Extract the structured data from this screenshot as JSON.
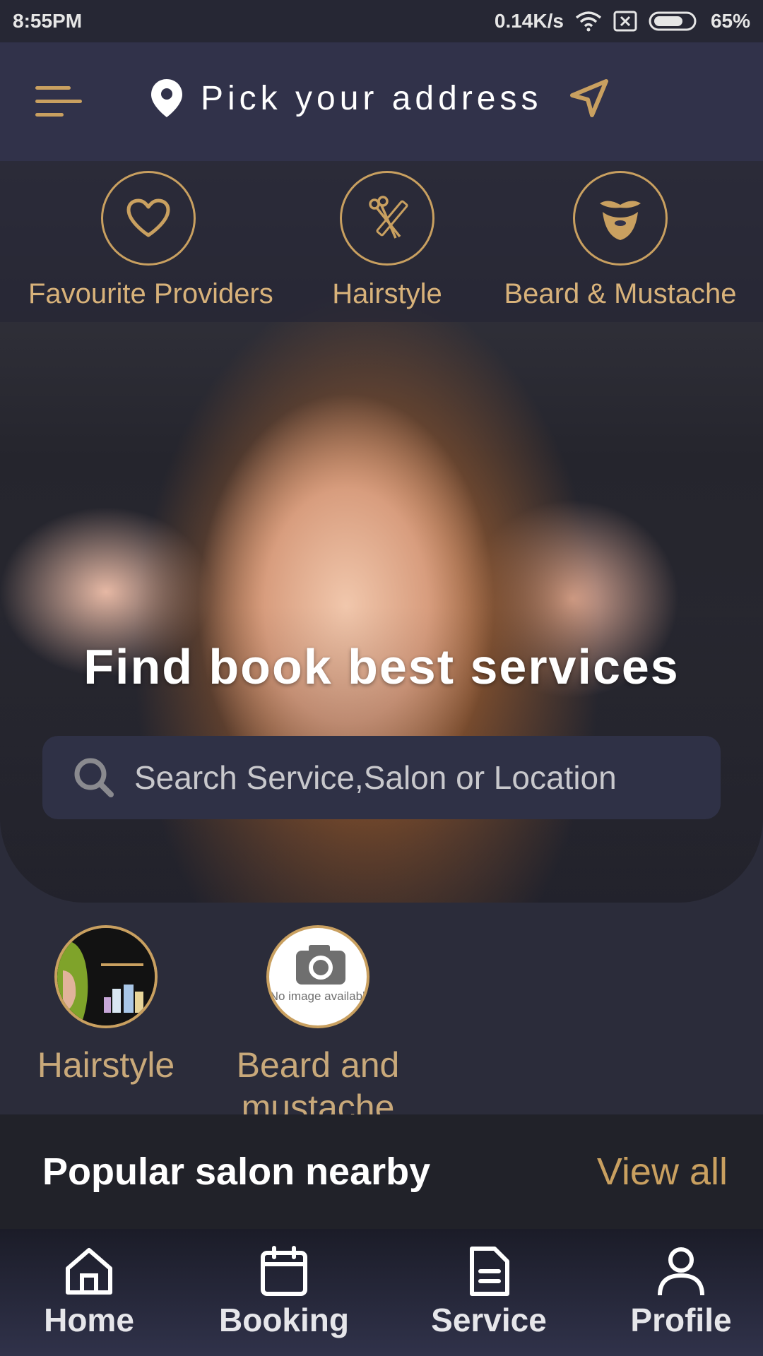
{
  "status_bar": {
    "time": "8:55PM",
    "network_speed": "0.14K/s",
    "battery": "65%"
  },
  "header": {
    "address_placeholder": "Pick your address"
  },
  "top_categories": [
    {
      "label": "Favourite Providers",
      "icon": "heart-icon"
    },
    {
      "label": "Hairstyle",
      "icon": "scissors-comb-icon"
    },
    {
      "label": "Beard & Mustache",
      "icon": "beard-icon"
    }
  ],
  "hero": {
    "title": "Find book best services"
  },
  "search": {
    "placeholder": "Search Service,Salon or Location"
  },
  "sub_categories": [
    {
      "label": "Hairstyle"
    },
    {
      "label": "Beard and mustache",
      "image_text": "No image available"
    }
  ],
  "popular": {
    "title": "Popular salon nearby",
    "view_all": "View all"
  },
  "bottom_nav": [
    {
      "label": "Home",
      "icon": "home-icon"
    },
    {
      "label": "Booking",
      "icon": "calendar-icon"
    },
    {
      "label": "Service",
      "icon": "document-icon"
    },
    {
      "label": "Profile",
      "icon": "user-icon"
    }
  ],
  "colors": {
    "accent": "#c9a060",
    "header": "#31324a",
    "background": "#2b2c3a"
  }
}
